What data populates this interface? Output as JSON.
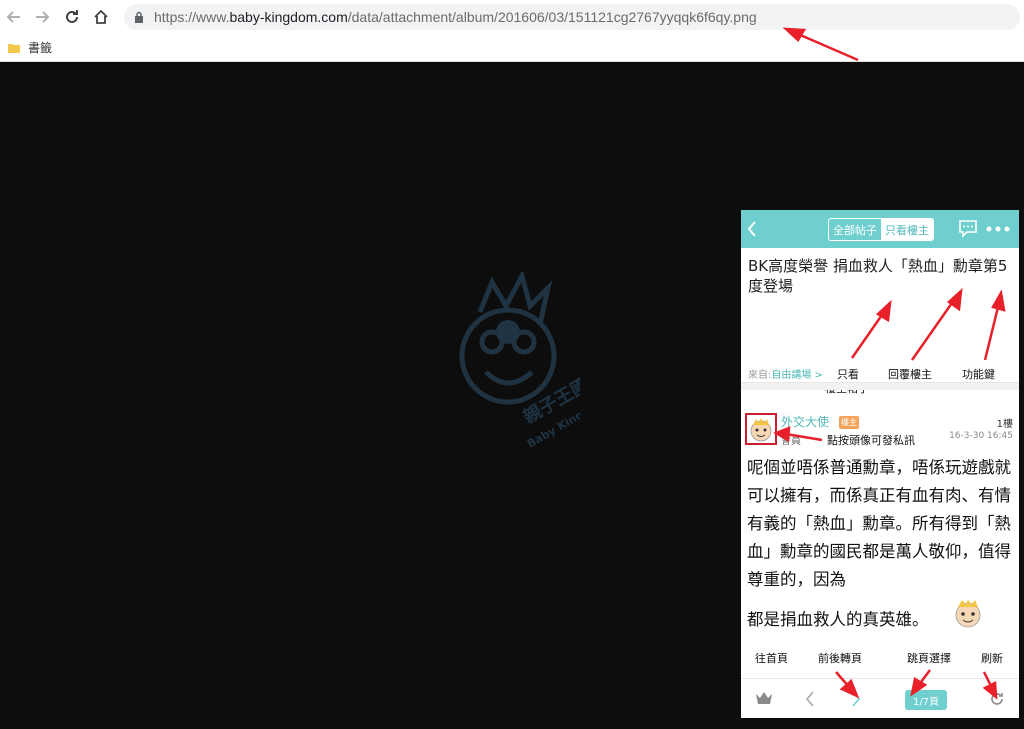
{
  "browser": {
    "url_prefix": "https://www.",
    "url_domain": "baby-kingdom.com",
    "url_path": "/data/attachment/album/201606/03/151121cg2767yyqqk6f6qy.png",
    "bookmark_folder": "書籤"
  },
  "watermark": {
    "brand_cn": "親子王國",
    "brand_en": "Baby Kingdom"
  },
  "post": {
    "tab_all": "全部帖子",
    "tab_op_only": "只看樓主",
    "title": "BK高度榮譽 捐血救人「熱血」勳章第5度登場",
    "from_label": "來自:",
    "forum": "自由講場 >",
    "username": "外交大使",
    "op_badge": "樓主",
    "floor": "1樓",
    "time": "16-3-30 16:45",
    "role": "會員",
    "body": "呢個並唔係普通勳章，唔係玩遊戲就可以擁有，而係真正有血有肉、有情有義的「熱血」勳章。所有得到「熱血」勳章的國民都是萬人敬仰，值得尊重的，因為",
    "body_last": "都是捐血救人的真英雄。",
    "page_indicator": "1/7頁"
  },
  "callouts": {
    "op_only_line1": "只看",
    "op_only_line2": "樓主帖子",
    "reply_op": "回覆樓主",
    "function_keys": "功能鍵",
    "avatar_tip": "點按頭像可發私訊",
    "home": "往首頁",
    "prev_next": "前後轉頁",
    "jump_page": "跳頁選擇",
    "refresh": "刷新"
  },
  "colors": {
    "header_teal": "#6fcfcf",
    "arrow_red": "#e8202a",
    "badge_orange": "#f5a35a"
  }
}
